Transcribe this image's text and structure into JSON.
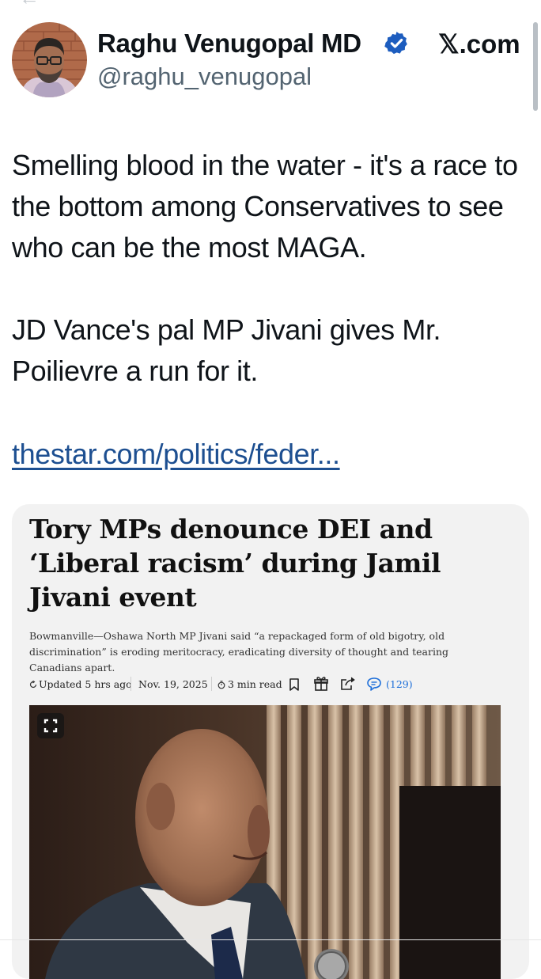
{
  "tweet": {
    "author_name": "Raghu Venugopal MD",
    "handle": "@raghu_venugopal",
    "source": "𝕏.com",
    "paragraph_1": "Smelling blood in the water - it's a race to the bottom among Conservatives to see who can be the most MAGA.",
    "paragraph_2": "JD Vance's pal MP Jivani gives Mr. Poilievre a run for it.",
    "link_text": "thestar.com/politics/feder..."
  },
  "article": {
    "headline": "Tory MPs denounce DEI and ‘Liberal racism’ during Jamil Jivani event",
    "summary": "Bowmanville—Oshawa North MP Jivani said “a repackaged form of old bigotry, old discrimination” is eroding meritocracy, eradicating diversity of thought and tearing Canadians apart.",
    "updated": "Updated 5 hrs ago",
    "date": "Nov. 19, 2025",
    "read_time": "3 min read",
    "comments": "(129)"
  },
  "icons": {
    "verified": "verified-badge-icon",
    "bookmark": "bookmark-icon",
    "gift": "gift-icon",
    "share": "share-icon",
    "comment": "comment-icon",
    "expand": "expand-icon"
  },
  "colors": {
    "text": "#0f1419",
    "secondary": "#536471",
    "verified_blue": "#1d5dbf",
    "link": "#1d4f91",
    "card_bg": "#f2f2f2",
    "comment_blue": "#1e6fd9"
  }
}
